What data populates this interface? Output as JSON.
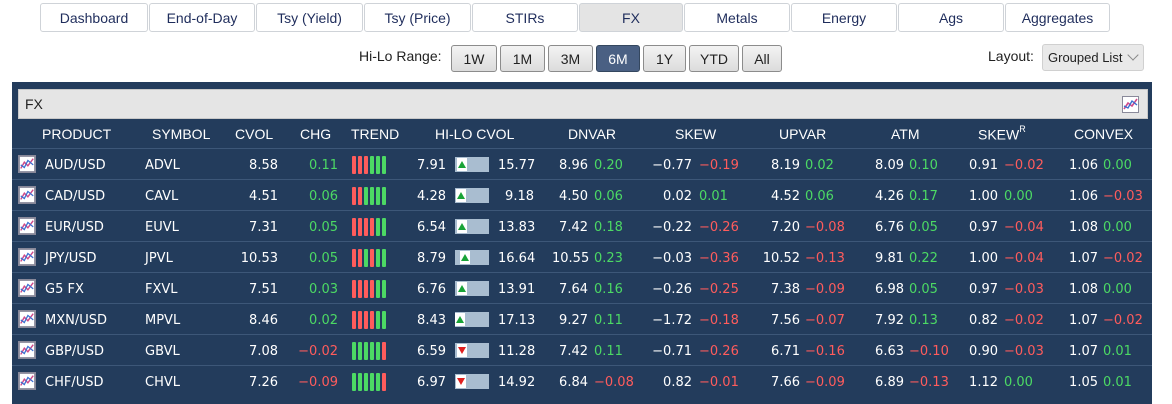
{
  "nav": [
    {
      "label": "Dashboard",
      "active": false
    },
    {
      "label": "End-of-Day",
      "active": false
    },
    {
      "label": "Tsy (Yield)",
      "active": false
    },
    {
      "label": "Tsy (Price)",
      "active": false
    },
    {
      "label": "STIRs",
      "active": false
    },
    {
      "label": "FX",
      "active": true
    },
    {
      "label": "Metals",
      "active": false
    },
    {
      "label": "Energy",
      "active": false
    },
    {
      "label": "Ags",
      "active": false
    },
    {
      "label": "Aggregates",
      "active": false
    }
  ],
  "range": {
    "label": "Hi-Lo Range:",
    "options": [
      {
        "label": "1W",
        "active": false
      },
      {
        "label": "1M",
        "active": false
      },
      {
        "label": "3M",
        "active": false
      },
      {
        "label": "6M",
        "active": true
      },
      {
        "label": "1Y",
        "active": false
      },
      {
        "label": "YTD",
        "active": false
      },
      {
        "label": "All",
        "active": false
      }
    ]
  },
  "layout": {
    "label": "Layout:",
    "selected": "Grouped List"
  },
  "panel": {
    "title": "FX",
    "icon": "chart-icon"
  },
  "columns": {
    "product": "PRODUCT",
    "symbol": "SYMBOL",
    "cvol": "CVOL",
    "chg": "CHG",
    "trend": "TREND",
    "hilo": "HI-LO CVOL",
    "dnvar": "DNVAR",
    "skew": "SKEW",
    "upvar": "UPVAR",
    "atm": "ATM",
    "skewr": "SKEW",
    "skewr_sup": "R",
    "convex": "CONVEX"
  },
  "colors": {
    "positive": "#4cd964",
    "negative": "#ff5c5c",
    "panel": "#233c5c",
    "active": "#4a6083"
  },
  "rows": [
    {
      "product": "AUD/USD",
      "symbol": "ADVL",
      "cvol": "8.58",
      "chg": "0.11",
      "trend": [
        "neg",
        "neg",
        "neg",
        "pos",
        "pos",
        "pos"
      ],
      "lo": "7.91",
      "hi": "15.77",
      "pos_frac": 0.08,
      "dir": "up",
      "dnvar": "8.96",
      "dnvar_chg": "0.20",
      "skew": "−0.77",
      "skew_chg": "−0.19",
      "upvar": "8.19",
      "upvar_chg": "0.02",
      "atm": "8.09",
      "atm_chg": "0.10",
      "skewr": "0.91",
      "skewr_chg": "−0.02",
      "convex": "1.06",
      "convex_chg": "0.00"
    },
    {
      "product": "CAD/USD",
      "symbol": "CAVL",
      "cvol": "4.51",
      "chg": "0.06",
      "trend": [
        "neg",
        "neg",
        "pos",
        "pos",
        "pos",
        "pos"
      ],
      "lo": "4.28",
      "hi": "9.18",
      "pos_frac": 0.05,
      "dir": "up",
      "dnvar": "4.50",
      "dnvar_chg": "0.06",
      "skew": "0.02",
      "skew_chg": "0.01",
      "upvar": "4.52",
      "upvar_chg": "0.06",
      "atm": "4.26",
      "atm_chg": "0.17",
      "skewr": "1.00",
      "skewr_chg": "0.00",
      "convex": "1.06",
      "convex_chg": "−0.03"
    },
    {
      "product": "EUR/USD",
      "symbol": "EUVL",
      "cvol": "7.31",
      "chg": "0.05",
      "trend": [
        "neg",
        "neg",
        "neg",
        "neg",
        "pos",
        "pos"
      ],
      "lo": "6.54",
      "hi": "13.83",
      "pos_frac": 0.1,
      "dir": "up",
      "dnvar": "7.42",
      "dnvar_chg": "0.18",
      "skew": "−0.22",
      "skew_chg": "−0.26",
      "upvar": "7.20",
      "upvar_chg": "−0.08",
      "atm": "6.76",
      "atm_chg": "0.05",
      "skewr": "0.97",
      "skewr_chg": "−0.04",
      "convex": "1.08",
      "convex_chg": "0.00"
    },
    {
      "product": "JPY/USD",
      "symbol": "JPVL",
      "cvol": "10.53",
      "chg": "0.05",
      "trend": [
        "neg",
        "neg",
        "pos",
        "neg",
        "pos",
        "pos"
      ],
      "lo": "8.79",
      "hi": "16.64",
      "pos_frac": 0.22,
      "dir": "up",
      "dnvar": "10.55",
      "dnvar_chg": "0.23",
      "skew": "−0.03",
      "skew_chg": "−0.36",
      "upvar": "10.52",
      "upvar_chg": "−0.13",
      "atm": "9.81",
      "atm_chg": "0.22",
      "skewr": "1.00",
      "skewr_chg": "−0.04",
      "convex": "1.07",
      "convex_chg": "−0.02"
    },
    {
      "product": "G5 FX",
      "symbol": "FXVL",
      "cvol": "7.51",
      "chg": "0.03",
      "trend": [
        "neg",
        "neg",
        "neg",
        "neg",
        "pos",
        "pos"
      ],
      "lo": "6.76",
      "hi": "13.91",
      "pos_frac": 0.1,
      "dir": "up",
      "dnvar": "7.64",
      "dnvar_chg": "0.16",
      "skew": "−0.26",
      "skew_chg": "−0.25",
      "upvar": "7.38",
      "upvar_chg": "−0.09",
      "atm": "6.98",
      "atm_chg": "0.05",
      "skewr": "0.97",
      "skewr_chg": "−0.03",
      "convex": "1.08",
      "convex_chg": "0.00"
    },
    {
      "product": "MXN/USD",
      "symbol": "MPVL",
      "cvol": "8.46",
      "chg": "0.02",
      "trend": [
        "neg",
        "neg",
        "neg",
        "neg",
        "pos",
        "pos"
      ],
      "lo": "8.43",
      "hi": "17.13",
      "pos_frac": 0.0,
      "dir": "up",
      "dnvar": "9.27",
      "dnvar_chg": "0.11",
      "skew": "−1.72",
      "skew_chg": "−0.18",
      "upvar": "7.56",
      "upvar_chg": "−0.07",
      "atm": "7.92",
      "atm_chg": "0.13",
      "skewr": "0.82",
      "skewr_chg": "−0.02",
      "convex": "1.07",
      "convex_chg": "−0.02"
    },
    {
      "product": "GBP/USD",
      "symbol": "GBVL",
      "cvol": "7.08",
      "chg": "−0.02",
      "trend": [
        "pos",
        "pos",
        "pos",
        "pos",
        "pos",
        "neg"
      ],
      "lo": "6.59",
      "hi": "11.28",
      "pos_frac": 0.1,
      "dir": "down",
      "dnvar": "7.42",
      "dnvar_chg": "0.11",
      "skew": "−0.71",
      "skew_chg": "−0.26",
      "upvar": "6.71",
      "upvar_chg": "−0.16",
      "atm": "6.63",
      "atm_chg": "−0.10",
      "skewr": "0.90",
      "skewr_chg": "−0.03",
      "convex": "1.07",
      "convex_chg": "0.01"
    },
    {
      "product": "CHF/USD",
      "symbol": "CHVL",
      "cvol": "7.26",
      "chg": "−0.09",
      "trend": [
        "pos",
        "pos",
        "pos",
        "pos",
        "pos",
        "neg"
      ],
      "lo": "6.97",
      "hi": "14.92",
      "pos_frac": 0.04,
      "dir": "down",
      "dnvar": "6.84",
      "dnvar_chg": "−0.08",
      "skew": "0.82",
      "skew_chg": "−0.01",
      "upvar": "7.66",
      "upvar_chg": "−0.09",
      "atm": "6.89",
      "atm_chg": "−0.13",
      "skewr": "1.12",
      "skewr_chg": "0.00",
      "convex": "1.05",
      "convex_chg": "0.01"
    }
  ]
}
